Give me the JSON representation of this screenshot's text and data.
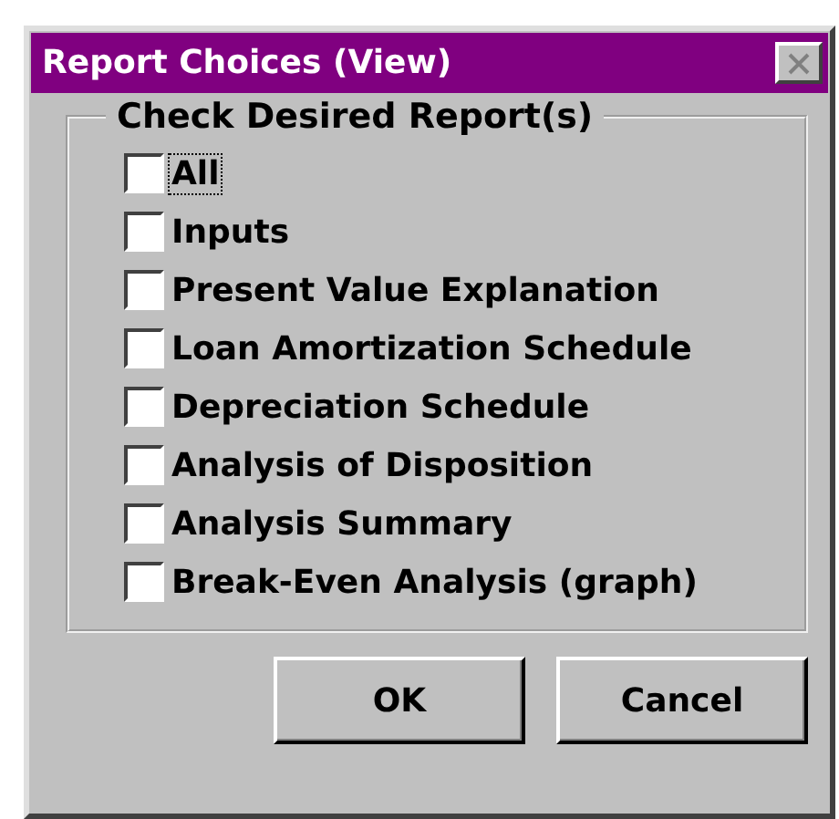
{
  "window": {
    "title": "Report Choices (View)"
  },
  "group": {
    "legend": "Check Desired Report(s)",
    "options": [
      {
        "label": "All",
        "checked": false,
        "focused": true
      },
      {
        "label": "Inputs",
        "checked": false,
        "focused": false
      },
      {
        "label": "Present Value Explanation",
        "checked": false,
        "focused": false
      },
      {
        "label": "Loan Amortization Schedule",
        "checked": false,
        "focused": false
      },
      {
        "label": "Depreciation Schedule",
        "checked": false,
        "focused": false
      },
      {
        "label": "Analysis of Disposition",
        "checked": false,
        "focused": false
      },
      {
        "label": "Analysis Summary",
        "checked": false,
        "focused": false
      },
      {
        "label": "Break-Even Analysis (graph)",
        "checked": false,
        "focused": false
      }
    ]
  },
  "buttons": [
    "OK",
    "Cancel"
  ]
}
